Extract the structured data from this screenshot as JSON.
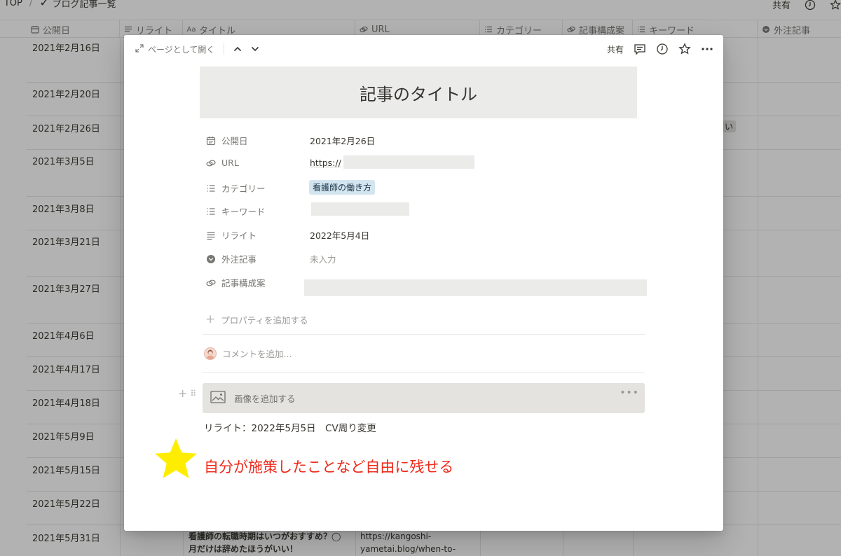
{
  "topbar": {
    "breadcrumb": [
      "TOP",
      "/",
      "ブログ記事一覧"
    ],
    "share_label": "共有",
    "icons": [
      "history-icon",
      "star-icon"
    ]
  },
  "table": {
    "columns": [
      {
        "label": "公開日",
        "icon": "calendar-icon"
      },
      {
        "label": "リライト",
        "icon": "text-lines-icon"
      },
      {
        "label": "タイトル",
        "icon": "text-icon"
      },
      {
        "label": "URL",
        "icon": "link-icon"
      },
      {
        "label": "カテゴリー",
        "icon": "list-icon"
      },
      {
        "label": "記事構成案",
        "icon": "link-icon"
      },
      {
        "label": "キーワード",
        "icon": "list-icon"
      },
      {
        "label": "外注記事",
        "icon": "select-icon"
      }
    ],
    "rows": [
      "2021年2月16日",
      "2021年2月20日",
      "2021年2月26日",
      "2021年3月5日",
      "2021年3月8日",
      "2021年3月21日",
      "2021年3月27日",
      "2021年4月6日",
      "2021年4月17日",
      "2021年4月18日",
      "2021年5月9日",
      "2021年5月15日",
      "2021年5月22日",
      "2021年5月31日"
    ],
    "last_row_title_line1": "看護師の転職時期はいつがおすすめ？◯",
    "last_row_title_line2": "月だけは辞めたほうがいい！",
    "last_row_url_line1": "https://kangoshi-",
    "last_row_url_line2": "yametai.blog/when-to-",
    "row3_tag_fragment": "い"
  },
  "modal": {
    "open_as_page": "ページとして開く",
    "share_label": "共有",
    "title": "記事のタイトル",
    "properties": {
      "publish": {
        "name": "公開日",
        "value": "2021年2月26日"
      },
      "url": {
        "name": "URL",
        "value": "https://"
      },
      "category": {
        "name": "カテゴリー",
        "value": "看護師の働き方"
      },
      "keyword": {
        "name": "キーワード"
      },
      "rewrite": {
        "name": "リライト",
        "value": "2022年5月4日"
      },
      "outsourced": {
        "name": "外注記事",
        "value": "未入力"
      },
      "outline": {
        "name": "記事構成案"
      }
    },
    "add_property": "プロパティを追加する",
    "add_comment": "コメントを追加...",
    "add_image": "画像を追加する",
    "note": "リライト：2022年5月5日　CV周り変更",
    "annotation": "自分が施策したことなど自由に残せる",
    "colors": {
      "annotation": "#ee2a1b",
      "star": "#ffed00",
      "tag_blue": "#d3e5ef"
    }
  }
}
